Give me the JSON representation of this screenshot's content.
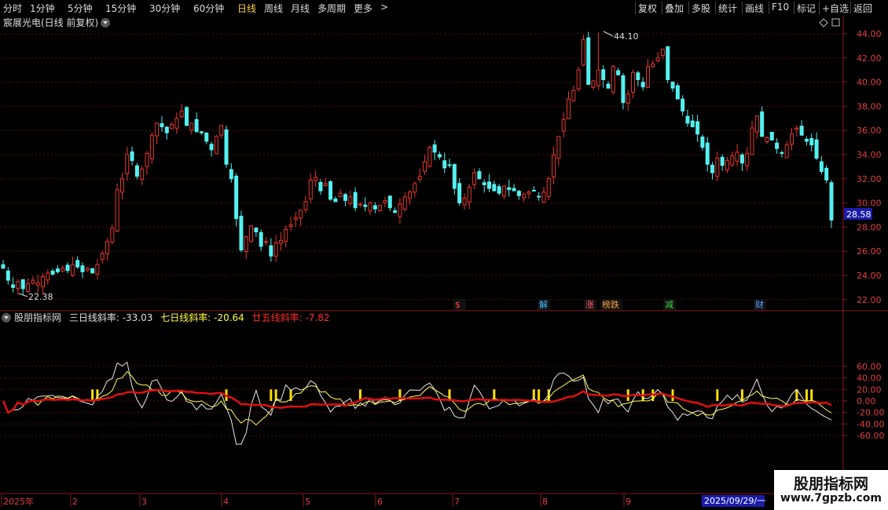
{
  "toolbar": {
    "periods": [
      {
        "label": "分时",
        "active": false
      },
      {
        "label": "1分钟",
        "active": false
      },
      {
        "label": "5分钟",
        "active": false
      },
      {
        "label": "15分钟",
        "active": false
      },
      {
        "label": "30分钟",
        "active": false
      },
      {
        "label": "60分钟",
        "active": false
      },
      {
        "label": "日线",
        "active": true
      },
      {
        "label": "周线",
        "active": false
      },
      {
        "label": "月线",
        "active": false
      },
      {
        "label": "多周期",
        "active": false
      },
      {
        "label": "更多",
        "active": false
      }
    ],
    "more_arrow": ">",
    "right_buttons": [
      "复权",
      "叠加",
      "多股",
      "统计",
      "画线",
      "F10",
      "标记",
      "+自选",
      "返回"
    ]
  },
  "main_chart": {
    "title": "宸展光电(日线 前复权)",
    "y_ticks": [
      "44.00",
      "42.00",
      "40.00",
      "38.00",
      "36.00",
      "34.00",
      "32.00",
      "30.00",
      "28.00",
      "26.00",
      "24.00",
      "22.00"
    ],
    "current_price": "28.58",
    "high_label": "44.10",
    "low_label": "22.38",
    "event_markers": [
      {
        "text": "$",
        "color": "#ff4040"
      },
      {
        "text": "解",
        "color": "#3fc0ff"
      },
      {
        "text": "涨",
        "color": "#ff6060"
      },
      {
        "text": "榜跌",
        "color": "#ffa040"
      },
      {
        "text": "减",
        "color": "#40d040"
      },
      {
        "text": "财",
        "color": "#60a0ff"
      }
    ]
  },
  "indicator": {
    "name": "股朋指标网",
    "series": [
      {
        "label": "三日线斜率:",
        "value": "-33.03",
        "color": "#e0e0e0"
      },
      {
        "label": "七日线斜率:",
        "value": "-20.64",
        "color": "#ffff40"
      },
      {
        "label": "廿五线斜率:",
        "value": "-7.82",
        "color": "#ff3030"
      }
    ],
    "y_ticks": [
      "60.00",
      "40.00",
      "20.00",
      "0.00",
      "-20.00",
      "-40.00",
      "-60.00"
    ]
  },
  "time_axis": {
    "labels": [
      "2025年",
      "2",
      "3",
      "4",
      "5",
      "6",
      "7",
      "8",
      "9"
    ],
    "cursor_date": "2025/09/29/一"
  },
  "watermark": {
    "line1": "股朋指标网",
    "line2": "www.7gpzb.com"
  },
  "colors": {
    "up": "#e8382b",
    "down": "#54f0f0",
    "axis": "#8b1a1a",
    "ma25": "#e01010",
    "slope7": "#ffff50",
    "bar": "#ffe000"
  },
  "chart_data": {
    "type": "candlestick",
    "title": "宸展光电(日线 前复权)",
    "y_range": [
      21.5,
      45
    ],
    "high": 44.1,
    "low": 22.38,
    "last": 28.58,
    "closes": [
      24.6,
      23.6,
      23.0,
      23.5,
      22.9,
      23.3,
      23.6,
      23.4,
      23.9,
      24.2,
      24.1,
      24.3,
      24.6,
      24.4,
      24.9,
      24.7,
      24.3,
      24.6,
      24.2,
      24.9,
      25.8,
      26.8,
      27.9,
      31.1,
      32.0,
      34.0,
      33.5,
      32.2,
      32.8,
      34.1,
      35.6,
      36.6,
      36.3,
      35.8,
      36.5,
      37.0,
      37.6,
      36.4,
      36.6,
      35.9,
      35.8,
      35.1,
      34.4,
      35.5,
      36.4,
      33.2,
      32.0,
      28.7,
      26.1,
      27.2,
      28.1,
      27.6,
      26.4,
      26.8,
      25.6,
      26.7,
      26.9,
      27.8,
      28.2,
      28.8,
      29.4,
      30.1,
      31.9,
      32.1,
      31.0,
      31.6,
      30.3,
      30.1,
      30.8,
      30.2,
      30.5,
      29.6,
      29.9,
      29.7,
      30.0,
      29.5,
      29.8,
      30.2,
      29.6,
      29.2,
      29.9,
      30.5,
      30.9,
      31.6,
      32.2,
      33.4,
      34.6,
      34.2,
      33.8,
      32.9,
      33.1,
      31.2,
      30.0,
      30.4,
      31.3,
      32.5,
      32.0,
      31.5,
      31.2,
      31.0,
      30.8,
      31.4,
      31.1,
      31.0,
      30.6,
      30.7,
      30.9,
      31.0,
      30.5,
      30.9,
      32.0,
      34.0,
      35.5,
      36.9,
      38.6,
      39.3,
      41.0,
      43.5,
      39.8,
      40.1,
      41.0,
      40.2,
      39.5,
      41.3,
      40.6,
      38.3,
      39.0,
      40.8,
      40.2,
      39.6,
      41.3,
      41.5,
      42.0,
      42.7,
      40.2,
      39.5,
      38.6,
      37.6,
      36.6,
      36.3,
      35.7,
      34.6,
      33.2,
      32.5,
      33.7,
      33.1,
      33.5,
      33.9,
      34.2,
      33.3,
      34.1,
      36.2,
      37.2,
      35.5,
      35.4,
      35.2,
      34.5,
      34.1,
      34.8,
      35.7,
      36.2,
      35.6,
      35.1,
      34.8,
      33.7,
      32.6,
      31.9,
      28.58
    ],
    "slope3_last": -33.03,
    "slope7_last": -20.64,
    "slope25_last": -7.82
  }
}
